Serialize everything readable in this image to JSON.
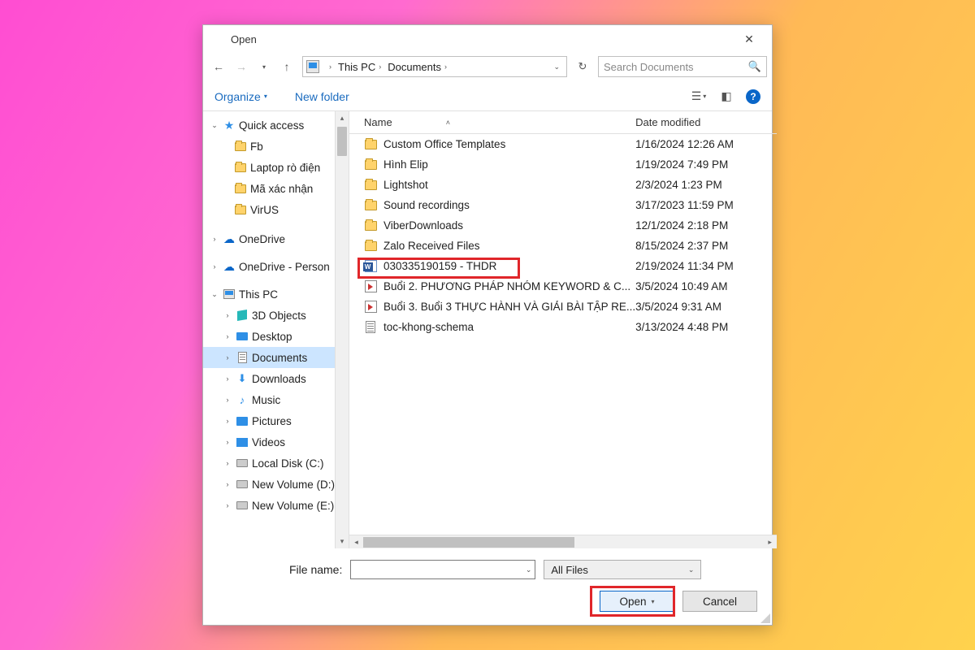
{
  "title": "Open",
  "breadcrumb": {
    "root": "This PC",
    "folder": "Documents"
  },
  "search_placeholder": "Search Documents",
  "toolbar": {
    "organize": "Organize",
    "newfolder": "New folder"
  },
  "sidebar": {
    "quick_access": "Quick access",
    "qa_items": [
      "Fb",
      "Laptop rò điện",
      "Mã xác nhận",
      "VirUS"
    ],
    "onedrive": "OneDrive",
    "onedrive_personal": "OneDrive - Person",
    "this_pc": "This PC",
    "pc_items": [
      "3D Objects",
      "Desktop",
      "Documents",
      "Downloads",
      "Music",
      "Pictures",
      "Videos",
      "Local Disk (C:)",
      "New Volume (D:)",
      "New Volume (E:)"
    ]
  },
  "columns": {
    "name": "Name",
    "date": "Date modified"
  },
  "files": [
    {
      "name": "Custom Office Templates",
      "date": "1/16/2024 12:26 AM",
      "type": "folder"
    },
    {
      "name": "Hình Elip",
      "date": "1/19/2024 7:49 PM",
      "type": "folder"
    },
    {
      "name": "Lightshot",
      "date": "2/3/2024 1:23 PM",
      "type": "folder"
    },
    {
      "name": "Sound recordings",
      "date": "3/17/2023 11:59 PM",
      "type": "folder"
    },
    {
      "name": "ViberDownloads",
      "date": "12/1/2024 2:18 PM",
      "type": "folder"
    },
    {
      "name": "Zalo Received Files",
      "date": "8/15/2024 2:37 PM",
      "type": "folder"
    },
    {
      "name": "030335190159 - THDR",
      "date": "2/19/2024 11:34 PM",
      "type": "word"
    },
    {
      "name": "Buổi 2. PHƯƠNG PHÁP NHÓM KEYWORD & C...",
      "date": "3/5/2024 10:49 AM",
      "type": "video"
    },
    {
      "name": "Buổi 3. Buổi 3 THỰC HÀNH VÀ GIẢI BÀI TẬP RE...",
      "date": "3/5/2024 9:31 AM",
      "type": "video"
    },
    {
      "name": "toc-khong-schema",
      "date": "3/13/2024 4:48 PM",
      "type": "txt"
    }
  ],
  "filename_label": "File name:",
  "filter": "All Files",
  "buttons": {
    "open": "Open",
    "cancel": "Cancel"
  }
}
